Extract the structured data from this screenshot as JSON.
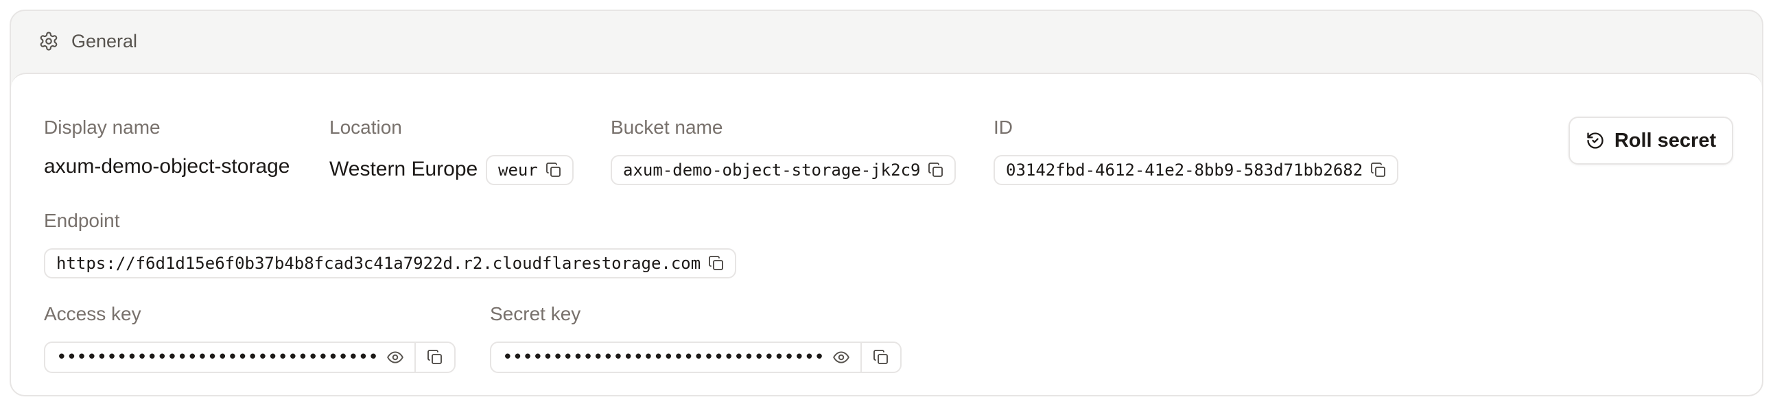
{
  "header": {
    "title": "General",
    "icon": "gear-icon"
  },
  "fields": {
    "display_name": {
      "label": "Display name",
      "value": "axum-demo-object-storage"
    },
    "location": {
      "label": "Location",
      "value": "Western Europe",
      "code": "weur"
    },
    "bucket_name": {
      "label": "Bucket name",
      "value": "axum-demo-object-storage-jk2c9"
    },
    "id": {
      "label": "ID",
      "value": "03142fbd-4612-41e2-8bb9-583d71bb2682"
    },
    "endpoint": {
      "label": "Endpoint",
      "value": "https://f6d1d15e6f0b37b4b8fcad3c41a7922d.r2.cloudflarestorage.com"
    },
    "access_key": {
      "label": "Access key",
      "value": "••••••••••••••••••••••••••••••••"
    },
    "secret_key": {
      "label": "Secret key",
      "value": "••••••••••••••••••••••••••••••••"
    }
  },
  "actions": {
    "roll_secret": "Roll secret"
  },
  "icons": {
    "copy": "copy-icon",
    "eye": "eye-icon",
    "roll": "rotate-icon"
  }
}
